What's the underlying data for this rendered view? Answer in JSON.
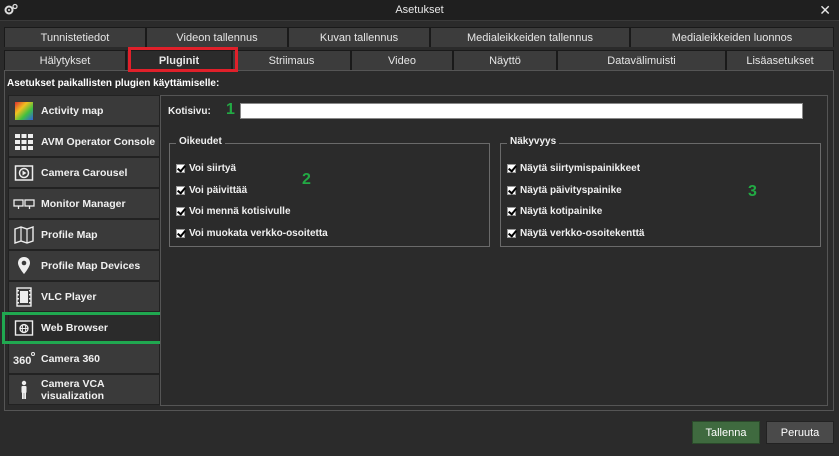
{
  "window": {
    "title": "Asetukset",
    "close": "✕"
  },
  "tabs_row1": [
    "Tunnistetiedot",
    "Videon tallennus",
    "Kuvan tallennus",
    "Medialeikkeiden tallennus",
    "Medialeikkeiden luonnos"
  ],
  "tabs_row1_labels": [
    "Tunnistetiedot",
    "Videon tallennus",
    "Kuvan tallennus",
    "Medialeikkeiden tallennus",
    "Medialeikkeiden luonnos"
  ],
  "tabs_row2": [
    "Hälytykset",
    "Pluginit",
    "Striimaus",
    "Video",
    "Näyttö",
    "Datavälimuisti",
    "Lisäasetukset"
  ],
  "active_tab": "Pluginit",
  "subtitle": "Asetukset paikallisten plugien käyttämiselle:",
  "plugins": [
    "Activity map",
    "AVM Operator Console",
    "Camera Carousel",
    "Monitor Manager",
    "Profile Map",
    "Profile Map Devices",
    "VLC Player",
    "Web Browser",
    "Camera 360",
    "Camera VCA visualization"
  ],
  "selected_plugin": "Web Browser",
  "home": {
    "label": "Kotisivu:",
    "value": ""
  },
  "annotations": {
    "n1": "1",
    "n2": "2",
    "n3": "3"
  },
  "rights": {
    "title": "Oikeudet",
    "items": [
      "Voi siirtyä",
      "Voi päivittää",
      "Voi mennä kotisivulle",
      "Voi muokata verkko-osoitetta"
    ]
  },
  "visibility": {
    "title": "Näkyvyys",
    "items": [
      "Näytä siirtymispainikkeet",
      "Näytä päivityspainike",
      "Näytä kotipainike",
      "Näytä verkko-osoitekenttä"
    ]
  },
  "buttons": {
    "save": "Tallenna",
    "cancel": "Peruuta"
  },
  "colors": {
    "annotation_red": "#e0202a",
    "annotation_green": "#20a850",
    "save_button": "#3f6a3f"
  }
}
